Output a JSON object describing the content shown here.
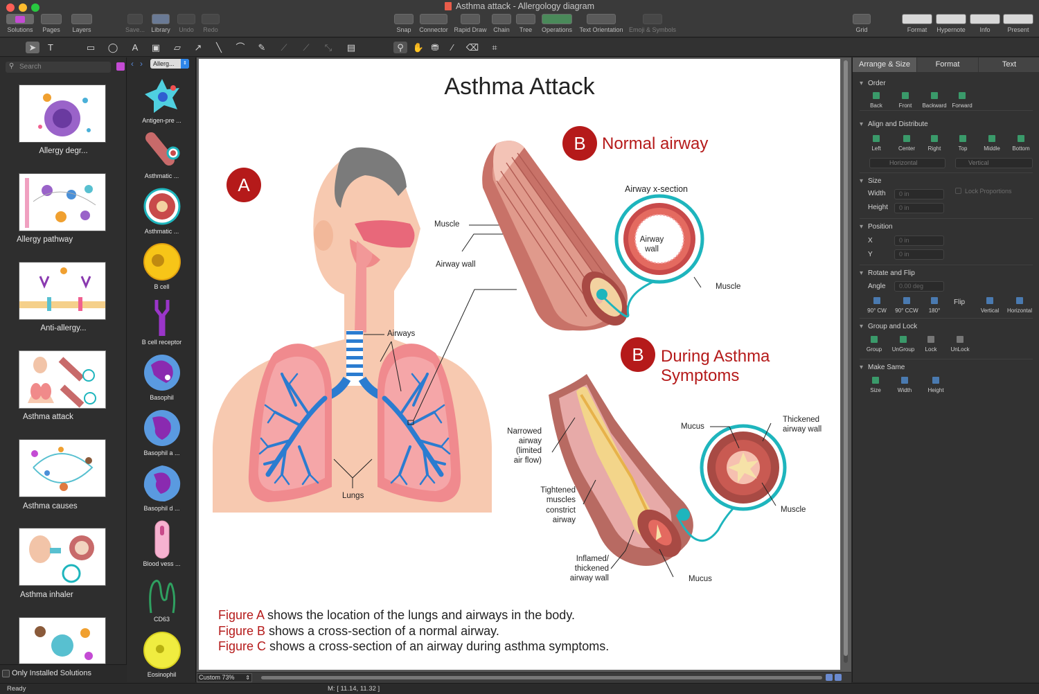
{
  "window": {
    "title": "Asthma attack - Allergology diagram"
  },
  "toolbar": {
    "left": [
      "Solutions",
      "Pages",
      "Layers",
      "Save...",
      "Library",
      "Undo",
      "Redo"
    ],
    "center": [
      "Snap",
      "Connector",
      "Rapid Draw",
      "Chain",
      "Tree",
      "Operations",
      "Text Orientation",
      "Emoji & Symbols"
    ],
    "right": [
      "Grid",
      "Format",
      "Hypernote",
      "Info",
      "Present"
    ]
  },
  "solutions": {
    "search_placeholder": "Search",
    "items": [
      "Allergy degr...",
      "Allergy pathway",
      "Anti-allergy...",
      "Asthma attack",
      "Asthma causes",
      "Asthma inhaler"
    ],
    "only_installed": "Only Installed Solutions"
  },
  "library": {
    "selector": "Allerg...",
    "items": [
      "Antigen-pre ...",
      "Asthmatic ...",
      "Asthmatic ...",
      "B cell",
      "B cell receptor",
      "Basophil",
      "Basophil a ...",
      "Basophil d ...",
      "Blood vess ...",
      "CD63",
      "Eosinophil"
    ]
  },
  "diagram": {
    "title": "Asthma Attack",
    "badge_a": "A",
    "badge_b": "B",
    "normal_airway": "Normal airway",
    "during_l1": "During Asthma",
    "during_l2": "Symptoms",
    "labels": {
      "muscle": "Muscle",
      "airway_wall": "Airway wall",
      "airway_xsection": "Airway x-section",
      "airway_wall_l1": "Airway",
      "airway_wall_l2": "wall",
      "muscle2": "Muscle",
      "airways": "Airways",
      "lungs": "Lungs",
      "mucus_top": "Mucus",
      "thickened_l1": "Thickened",
      "thickened_l2": "airway wall",
      "muscle3": "Muscle",
      "mucus_bottom": "Mucus",
      "narrowed_l1": "Narrowed",
      "narrowed_l2": "airway",
      "narrowed_l3": "(limited",
      "narrowed_l4": "air flow)",
      "tightened_l1": "Tightened",
      "tightened_l2": "muscles",
      "tightened_l3": "constrict",
      "tightened_l4": "airway",
      "inflamed_l1": "Inflamed/",
      "inflamed_l2": "thickened",
      "inflamed_l3": "airway wall"
    },
    "captions": [
      {
        "fig": "Figure A",
        "text": " shows the location of the lungs and airways in the body."
      },
      {
        "fig": "Figure B",
        "text": " shows a cross-section of a normal airway."
      },
      {
        "fig": "Figure C",
        "text": " shows a cross-section of an airway during asthma symptoms."
      }
    ]
  },
  "inspector": {
    "tabs": [
      "Arrange & Size",
      "Format",
      "Text"
    ],
    "order": {
      "title": "Order",
      "buttons": [
        "Back",
        "Front",
        "Backward",
        "Forward"
      ]
    },
    "align": {
      "title": "Align and Distribute",
      "buttons": [
        "Left",
        "Center",
        "Right",
        "Top",
        "Middle",
        "Bottom"
      ],
      "horizontal": "Horizontal",
      "vertical": "Vertical"
    },
    "size": {
      "title": "Size",
      "width_label": "Width",
      "height_label": "Height",
      "width": "0 in",
      "height": "0 in",
      "lock": "Lock Proportions"
    },
    "position": {
      "title": "Position",
      "x_label": "X",
      "y_label": "Y",
      "x": "0 in",
      "y": "0 in"
    },
    "rotate": {
      "title": "Rotate and Flip",
      "angle_label": "Angle",
      "angle": "0.00 deg",
      "buttons": [
        "90° CW",
        "90° CCW",
        "180°"
      ],
      "flip": "Flip",
      "flip_buttons": [
        "Vertical",
        "Horizontal"
      ]
    },
    "group": {
      "title": "Group and Lock",
      "buttons": [
        "Group",
        "UnGroup",
        "Lock",
        "UnLock"
      ]
    },
    "same": {
      "title": "Make Same",
      "buttons": [
        "Size",
        "Width",
        "Height"
      ]
    }
  },
  "status": {
    "ready": "Ready",
    "zoom": "Custom 73%",
    "mouse": "M: [ 11.14, 11.32 ]"
  },
  "colors": {
    "accent_red": "#b51a1a",
    "teal": "#1eb5bd",
    "canvas_bg": "#ffffff"
  }
}
